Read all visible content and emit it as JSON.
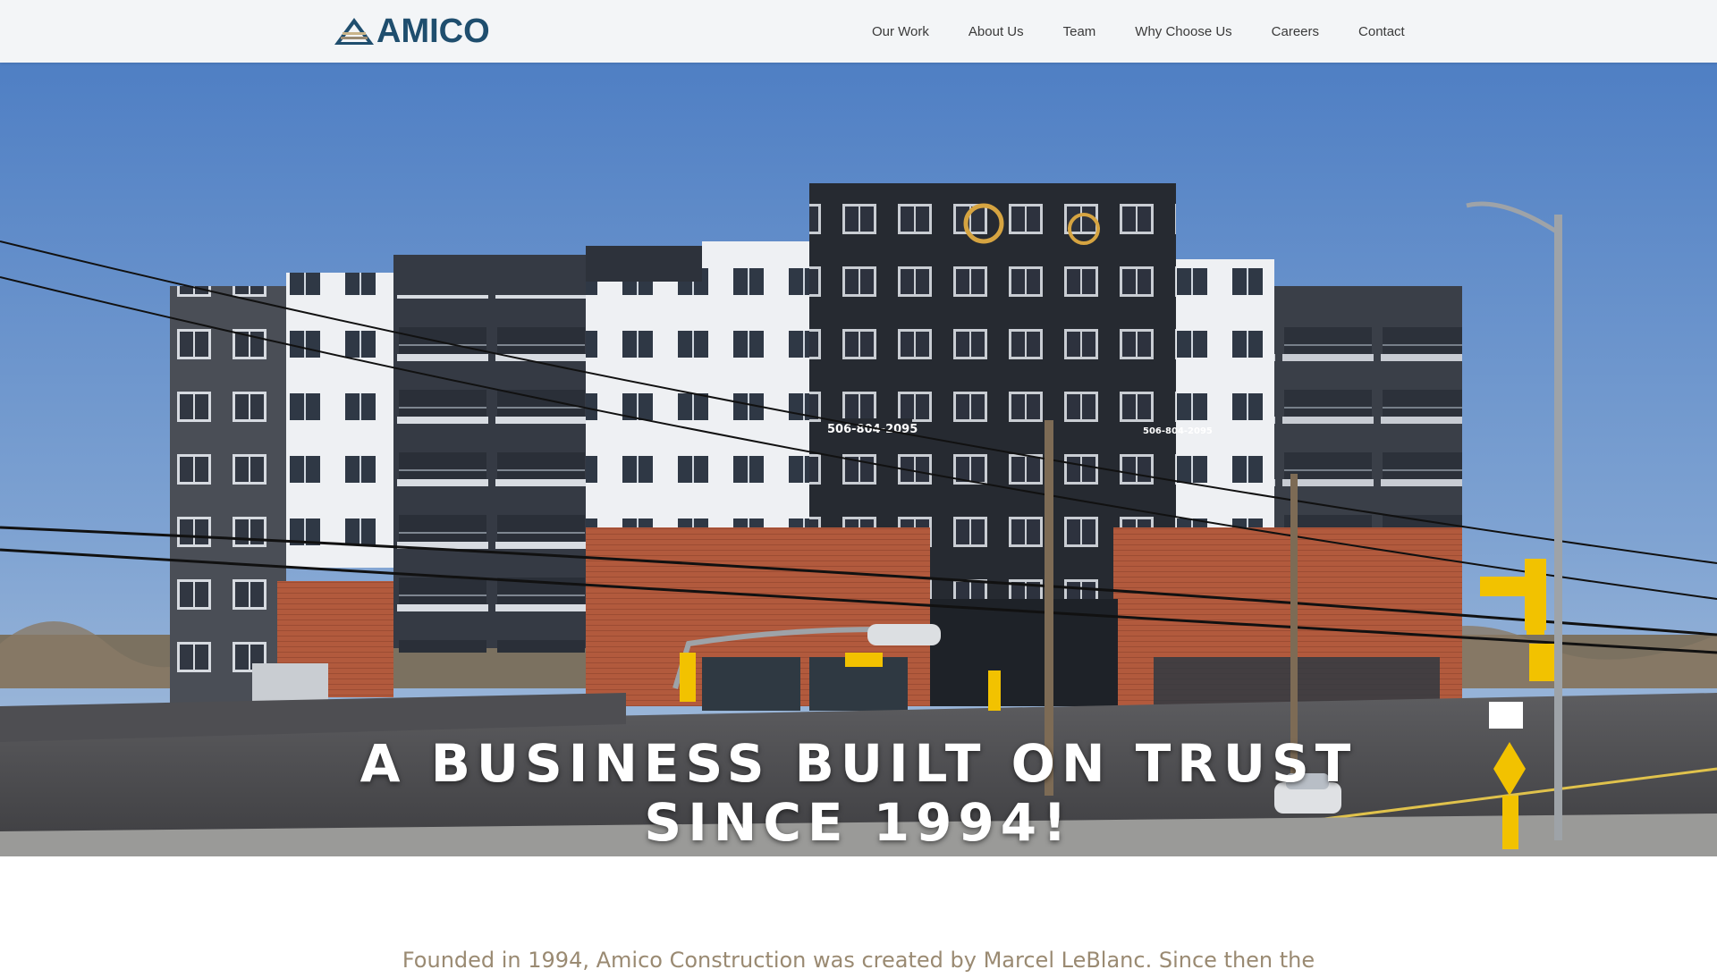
{
  "brand": {
    "name": "AMICO",
    "logo_icon": "triangle-layers-icon",
    "color": "#1f4e6e"
  },
  "nav": [
    {
      "label": "Our Work"
    },
    {
      "label": "About Us"
    },
    {
      "label": "Team"
    },
    {
      "label": "Why Choose Us"
    },
    {
      "label": "Careers"
    },
    {
      "label": "Contact"
    }
  ],
  "hero": {
    "title_line1": "A BUSINESS BUILT ON TRUST",
    "title_line2": "SINCE 1994!",
    "image_description_icon": "apartment-building-photo",
    "building_sign_main": "506-804-2095",
    "building_sign_side": "506-804-2095"
  },
  "intro": {
    "text": "Founded in 1994, Amico Construction was created by Marcel LeBlanc. Since then the"
  },
  "colors": {
    "header_bg": "#f3f5f7",
    "brand": "#1f4e6e",
    "intro_text": "#9a8a72"
  }
}
